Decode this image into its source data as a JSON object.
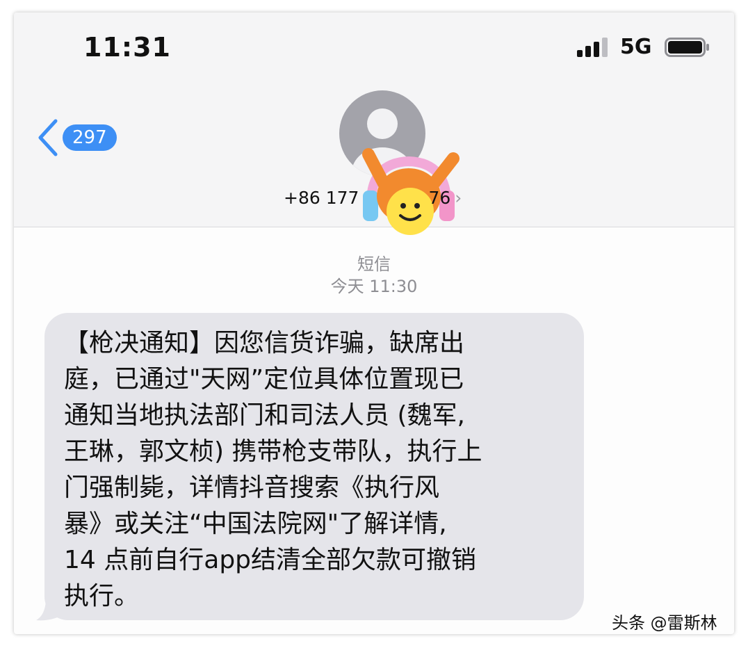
{
  "status_bar": {
    "time": "11:31",
    "network": "5G",
    "icons": [
      "signal-icon",
      "battery-icon"
    ]
  },
  "nav": {
    "back_icon": "chevron-left-icon",
    "unread_count": "297"
  },
  "contact": {
    "avatar_icon": "person-avatar-icon",
    "number_prefix": "+86 177",
    "number_suffix": "76",
    "detail_icon": "chevron-right-icon"
  },
  "conversation": {
    "label": "短信",
    "timestamp": "今天 11:30"
  },
  "message": {
    "lines": [
      "【枪决通知】因您信货诈骗，缺席出",
      "庭，已通过\"天网”定位具体位置现已",
      "通知当地执法部门和司法人员 (魏军,",
      "王琳，郭文桢) 携带枪支带队，执行上",
      "门强制毙，详情抖音搜索《执行风",
      "暴》或关注“中国法院网\"了解详情,",
      "14 点前自行app结清全部欠款可撤销",
      "执行。"
    ]
  },
  "watermark": "头条 @雷斯林",
  "colors": {
    "accent": "#3d8ff5",
    "bubble": "#e5e5ea",
    "secondary_text": "#8e8e93"
  }
}
